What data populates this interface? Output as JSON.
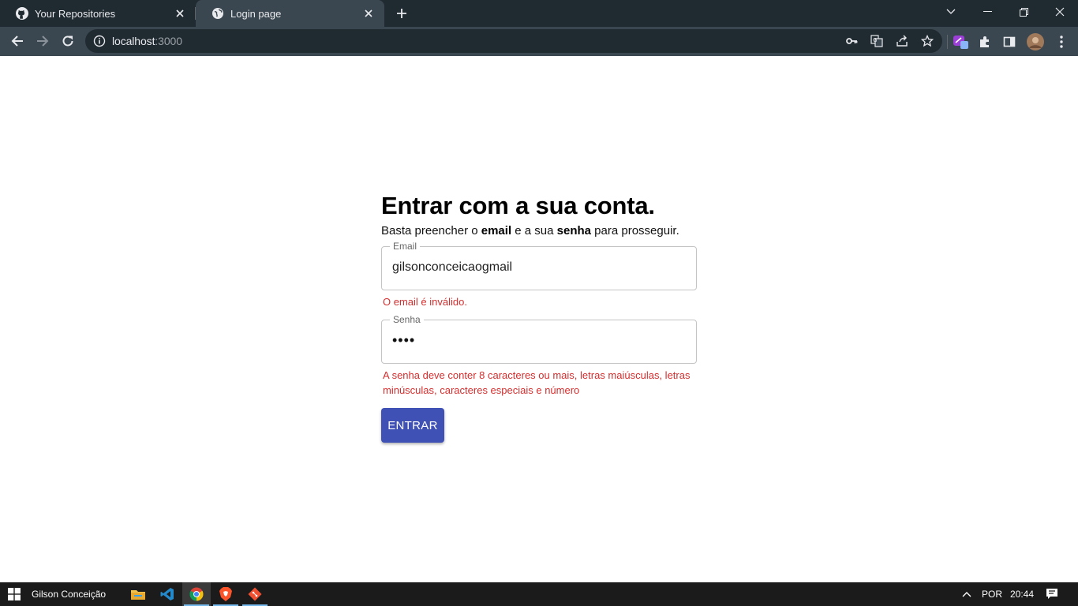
{
  "browser": {
    "tabs": [
      {
        "title": "Your Repositories",
        "icon": "github-icon"
      },
      {
        "title": "Login page",
        "icon": "globe-icon",
        "active": true
      }
    ],
    "url_host": "localhost",
    "url_port": ":3000"
  },
  "login": {
    "heading": "Entrar com a sua conta.",
    "subtitle_prefix": "Basta preencher o ",
    "subtitle_email": "email",
    "subtitle_mid": " e a sua ",
    "subtitle_senha": "senha",
    "subtitle_suffix": " para prosseguir.",
    "email_label": "Email",
    "email_value": "gilsonconceicaogmail",
    "email_error": "O email é inválido.",
    "password_label": "Senha",
    "password_value": "••••",
    "password_error": "A senha deve conter 8 caracteres ou mais, letras maiúsculas, letras minúsculas, caracteres especiais e número",
    "submit_label": "ENTRAR"
  },
  "taskbar": {
    "user": "Gilson Conceição",
    "language": "POR",
    "time": "20:44"
  },
  "colors": {
    "primary": "#3f51b5",
    "error": "#d32f2f",
    "chrome_dark": "#202a31",
    "chrome_toolbar": "#3b4750"
  }
}
